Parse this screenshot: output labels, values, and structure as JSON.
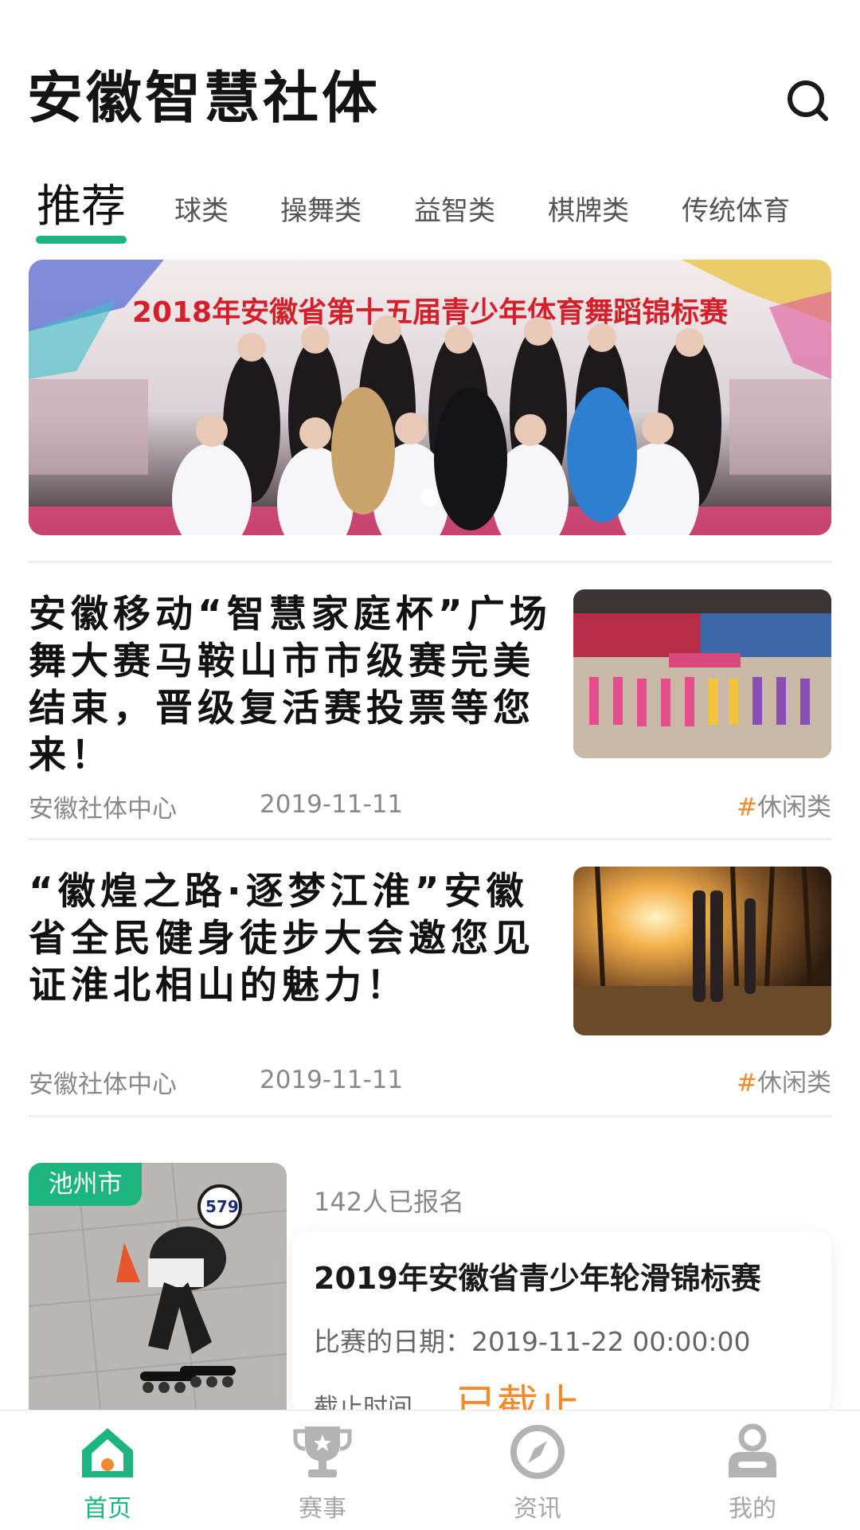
{
  "header": {
    "app_title": "安徽智慧社体",
    "search_icon": "search-icon"
  },
  "tabs": [
    {
      "label": "推荐",
      "active": true
    },
    {
      "label": "球类",
      "active": false
    },
    {
      "label": "操舞类",
      "active": false
    },
    {
      "label": "益智类",
      "active": false
    },
    {
      "label": "棋牌类",
      "active": false
    },
    {
      "label": "传统体育",
      "active": false
    }
  ],
  "banner": {
    "headline": "2018年安徽省第十五届青少年体育舞蹈锦标赛",
    "slide_index": 1,
    "slide_count": 1
  },
  "news": [
    {
      "title": "安徽移动“智慧家庭杯”广场舞大赛马鞍山市市级赛完美结束，晋级复活赛投票等您来！",
      "source": "安徽社体中心",
      "date": "2019-11-11",
      "tag_hash": "#",
      "tag": "休闲类"
    },
    {
      "title": "“徽煌之路·逐梦江淮”安徽省全民健身徒步大会邀您见证淮北相山的魅力！",
      "source": "安徽社体中心",
      "date": "2019-11-11",
      "tag_hash": "#",
      "tag": "休闲类"
    }
  ],
  "event": {
    "city": "池州市",
    "signup_count": "142人已报名",
    "title": "2019年安徽省青少年轮滑锦标赛",
    "date_label": "比赛的日期：2019-11-22 00:00:00",
    "deadline_label": "截止时间",
    "status": "已截止",
    "bib_number": "579"
  },
  "bottom_nav": [
    {
      "label": "首页",
      "icon": "home-icon",
      "active": true
    },
    {
      "label": "赛事",
      "icon": "trophy-icon",
      "active": false
    },
    {
      "label": "资讯",
      "icon": "compass-icon",
      "active": false
    },
    {
      "label": "我的",
      "icon": "user-icon",
      "active": false
    }
  ],
  "colors": {
    "accent": "#1db57e",
    "tag_hash": "#f28a2e",
    "status": "#f28a2e",
    "inactive_nav": "#a6a6a6"
  }
}
